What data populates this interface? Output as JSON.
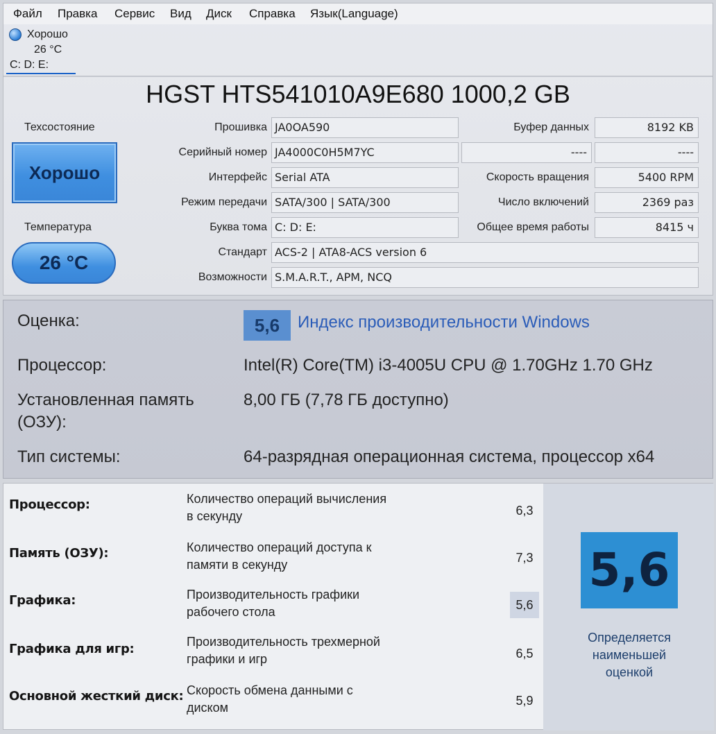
{
  "menu": {
    "items": [
      "Файл",
      "Правка",
      "Сервис",
      "Вид",
      "Диск",
      "Справка",
      "Язык(Language)"
    ]
  },
  "drive_tab": {
    "status": "Хорошо",
    "temp": "26 °C",
    "letters": "C: D: E:"
  },
  "disk": {
    "title": "HGST HTS541010A9E680 1000,2 GB",
    "health_label": "Техсостояние",
    "health_value": "Хорошо",
    "temp_label": "Температура",
    "temp_value": "26 °C",
    "fields": {
      "firmware": {
        "label": "Прошивка",
        "value": "JA0OA590"
      },
      "serial": {
        "label": "Серийный номер",
        "value": "JA4000C0H5M7YC"
      },
      "interface": {
        "label": "Интерфейс",
        "value": "Serial ATA"
      },
      "transfer": {
        "label": "Режим передачи",
        "value": "SATA/300 | SATA/300"
      },
      "volume": {
        "label": "Буква тома",
        "value": "C: D: E:"
      },
      "standard": {
        "label": "Стандарт",
        "value": "ACS-2 | ATA8-ACS version 6"
      },
      "features": {
        "label": "Возможности",
        "value": "S.M.A.R.T., APM, NCQ"
      },
      "buffer": {
        "label": "Буфер данных",
        "value": "8192 KB"
      },
      "unknown_label": "----",
      "unknown_value": "----",
      "rpm": {
        "label": "Скорость вращения",
        "value": "5400 RPM"
      },
      "power_count": {
        "label": "Число включений",
        "value": "2369 раз"
      },
      "power_hours": {
        "label": "Общее время работы",
        "value": "8415 ч"
      }
    }
  },
  "system": {
    "rating_label": "Оценка:",
    "rating_value": "5,6",
    "rating_link": "Индекс производительности Windows",
    "cpu_label": "Процессор:",
    "cpu_value": "Intel(R) Core(TM) i3-4005U CPU @ 1.70GHz   1.70 GHz",
    "ram_label_1": "Установленная память",
    "ram_label_2": "(ОЗУ):",
    "ram_value": "8,00 ГБ (7,78 ГБ доступно)",
    "type_label": "Тип системы:",
    "type_value": "64-разрядная операционная система, процессор x64"
  },
  "wei": {
    "rows": [
      {
        "component": "Процессор:",
        "desc_1": "Количество операций вычисления",
        "desc_2": "в секунду",
        "score": "6,3"
      },
      {
        "component": "Память (ОЗУ):",
        "desc_1": "Количество операций доступа к",
        "desc_2": "памяти в секунду",
        "score": "7,3"
      },
      {
        "component": "Графика:",
        "desc_1": "Производительность графики",
        "desc_2": "рабочего стола",
        "score": "5,6"
      },
      {
        "component": "Графика для игр:",
        "desc_1": "Производительность трехмерной",
        "desc_2": "графики и игр",
        "score": "6,5"
      },
      {
        "component": "Основной жесткий диск:",
        "desc_1": "Скорость обмена данными с",
        "desc_2": "диском",
        "score": "5,9"
      }
    ],
    "base_score": "5,6",
    "note_1": "Определяется",
    "note_2": "наименьшей",
    "note_3": "оценкой",
    "lowest_color": "#2d8fd3"
  }
}
